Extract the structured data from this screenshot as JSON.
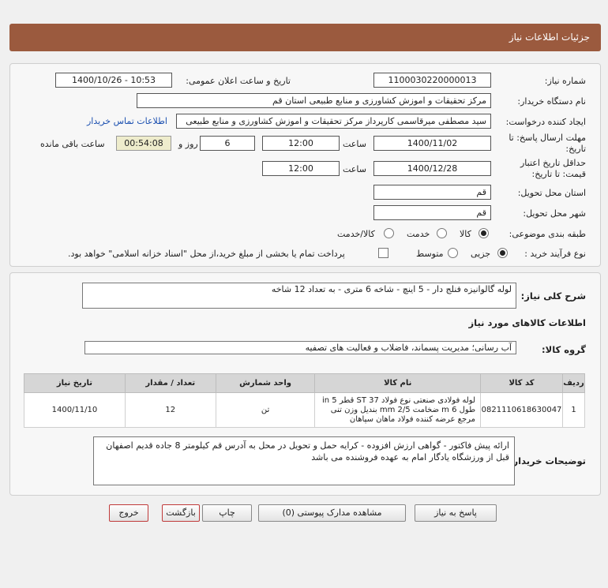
{
  "header": {
    "title": "جزئیات اطلاعات نیاز"
  },
  "form": {
    "need_number_label": "شماره نیاز:",
    "need_number": "1100030220000013",
    "announce_label": "تاریخ و ساعت اعلان عمومی:",
    "announce_value": "1400/10/26 - 10:53",
    "buyer_label": "نام دستگاه خریدار:",
    "buyer_value": "مرکز تحقیقات و اموزش کشاورزی و منابع طبیعی استان قم",
    "creator_label": "ایجاد کننده درخواست:",
    "creator_value": "سید مصطفی میرقاسمی کارپرداز مرکز تحقیقات و اموزش کشاورزی و منابع طبیعی",
    "contact_link": "اطلاعات تماس خریدار",
    "deadline_label_1": "مهلت ارسال پاسخ: تا",
    "deadline_label_2": "تاریخ:",
    "deadline_date": "1400/11/02",
    "time_label": "ساعت",
    "deadline_time": "12:00",
    "days_value": "6",
    "days_label": "روز و",
    "remaining_time": "00:54:08",
    "remaining_label": "ساعت باقی مانده",
    "validity_label_1": "حداقل تاریخ اعتبار",
    "validity_label_2": "قیمت: تا تاریخ:",
    "validity_date": "1400/12/28",
    "validity_time": "12:00",
    "province_label": "استان محل تحویل:",
    "province_value": "قم",
    "city_label": "شهر محل تحویل:",
    "city_value": "قم",
    "category_label": "طبقه بندی موضوعی:",
    "category_options": [
      "کالا",
      "خدمت",
      "کالا/خدمت"
    ],
    "process_label": "نوع فرآیند خرید :",
    "process_options": [
      "جزیی",
      "متوسط"
    ],
    "payment_note": "پرداخت تمام یا بخشی از مبلغ خرید،از محل \"اسناد خزانه اسلامی\" خواهد بود."
  },
  "details": {
    "summary_label": "شرح کلی نیاز:",
    "summary_value": "لوله گالوانیزه فنلج دار - 5 اینچ - شاخه 6 متری - به تعداد  12 شاخه",
    "goods_info_title": "اطلاعات کالاهای مورد نیاز",
    "group_label": "گروه کالا:",
    "group_value": "آب رسانی؛ مدیریت پسماند، فاضلاب و فعالیت های تصفیه",
    "table": {
      "headers": [
        "ردیف",
        "کد کالا",
        "نام کالا",
        "واحد شمارش",
        "تعداد / مقدار",
        "تاریخ نیاز"
      ],
      "rows": [
        {
          "row": "1",
          "code": "0821110618630047",
          "name": "لوله فولادی صنعتی نوع فولاد ST 37 قطر 5 in طول 6 m ضخامت 2/5 mm بندیل وزن تنی مرجع عرضه کننده فولاد ماهان سپاهان",
          "unit": "تن",
          "qty": "12",
          "date": "1400/11/10"
        }
      ]
    },
    "buyer_notes_label": "توضیحات خریدار:",
    "buyer_notes": "ارائه پیش فاکتور - گواهی ارزش افزوده - کرایه حمل و تحویل در محل به آدرس قم کیلومتر 8 جاده قدیم اصفهان قبل از ورزشگاه یادگار امام به عهده فروشنده می باشد"
  },
  "buttons": {
    "reply": "پاسخ به نیاز",
    "attachments": "مشاهده مدارک پیوستی (0)",
    "print": "چاپ",
    "back": "بازگشت",
    "exit": "خروج"
  },
  "colors": {
    "header_bg": "#9b5a3e",
    "link": "#1a4fb0",
    "exit_border": "#c03a3a"
  }
}
